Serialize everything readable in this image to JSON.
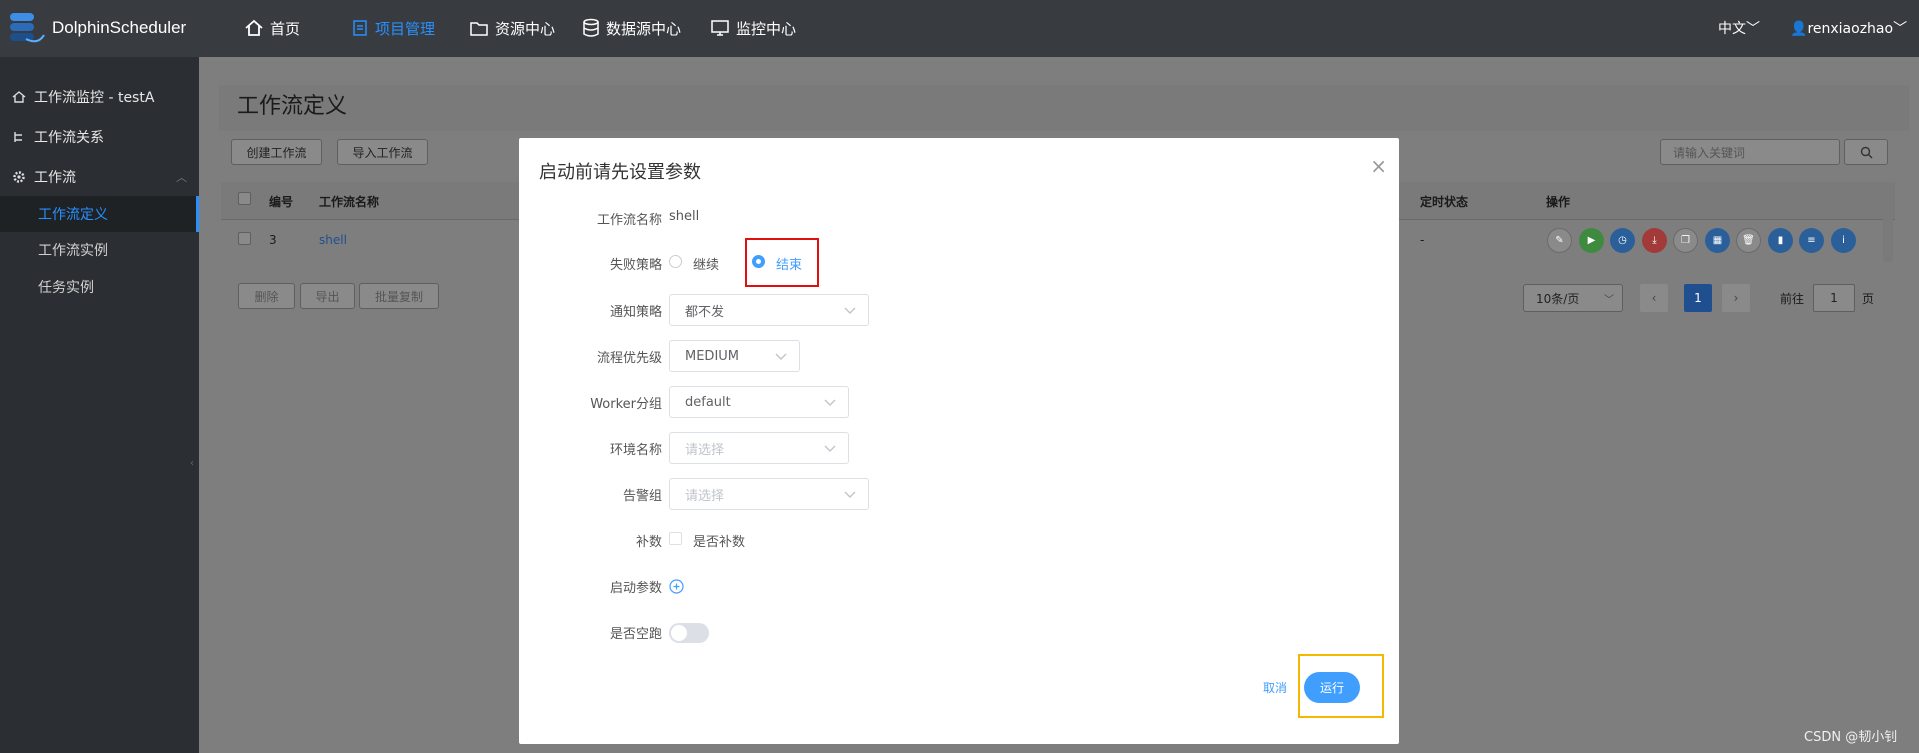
{
  "app": {
    "name": "DolphinScheduler"
  },
  "nav": [
    {
      "label": "首页",
      "icon": "home-icon"
    },
    {
      "label": "项目管理",
      "icon": "project-icon"
    },
    {
      "label": "资源中心",
      "icon": "folder-icon"
    },
    {
      "label": "数据源中心",
      "icon": "database-icon"
    },
    {
      "label": "监控中心",
      "icon": "monitor-icon"
    }
  ],
  "top_right": {
    "language": "中文",
    "user": "renxiaozhao"
  },
  "sidebar": {
    "items": [
      {
        "label": "工作流监控 - testA",
        "icon": "home-icon"
      },
      {
        "label": "工作流关系",
        "icon": "relation-icon"
      },
      {
        "label": "工作流",
        "icon": "gear-icon"
      }
    ],
    "subitems": [
      {
        "label": "工作流定义"
      },
      {
        "label": "工作流实例"
      },
      {
        "label": "任务实例"
      }
    ]
  },
  "main": {
    "title": "工作流定义",
    "create_btn": "创建工作流",
    "import_btn": "导入工作流",
    "search_placeholder": "请输入关键词",
    "columns": [
      "编号",
      "工作流名称",
      "定时状态",
      "操作"
    ],
    "row": {
      "id": "3",
      "name": "shell",
      "timing": "-"
    },
    "bottom_btns": [
      "删除",
      "导出",
      "批量复制"
    ],
    "pager": {
      "page_size": "10条/页",
      "current": "1",
      "goto_label": "前往",
      "goto_value": "1",
      "page_unit": "页"
    }
  },
  "modal": {
    "title": "启动前请先设置参数",
    "close": "×",
    "workflow_name_label": "工作流名称",
    "workflow_name_value": "shell",
    "failure_label": "失败策略",
    "failure_continue": "继续",
    "failure_end": "结束",
    "notify_label": "通知策略",
    "notify_value": "都不发",
    "priority_label": "流程优先级",
    "priority_value": "MEDIUM",
    "worker_label": "Worker分组",
    "worker_value": "default",
    "env_label": "环境名称",
    "env_placeholder": "请选择",
    "alarm_label": "告警组",
    "alarm_placeholder": "请选择",
    "complement_label": "补数",
    "complement_checkbox": "是否补数",
    "startup_params_label": "启动参数",
    "dry_run_label": "是否空跑",
    "cancel": "取消",
    "run": "运行"
  },
  "watermark": "CSDN @韧小钊",
  "colors": {
    "accent": "#409eff",
    "topbar": "#383c40",
    "sidebar": "#2b2f33",
    "highlight_red": "#e01010",
    "highlight_yellow": "#f5b800"
  }
}
